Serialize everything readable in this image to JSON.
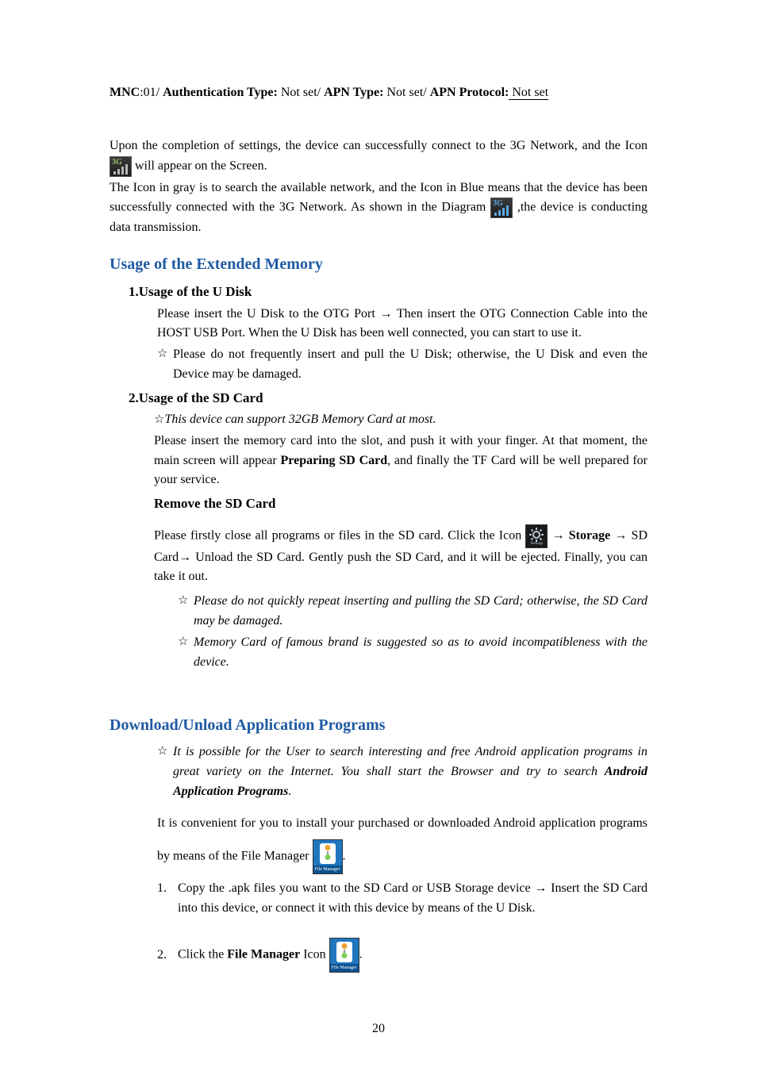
{
  "header": {
    "mnc_label": "MNC",
    "mnc_value": ":01/ ",
    "auth_label": "Authentication Type:",
    "auth_value": " Not set/   ",
    "apn_type_label": "APN Type:",
    "apn_type_value": " Not set/   ",
    "apn_proto_label": "APN Protocol:",
    "apn_proto_value": " Not set"
  },
  "para1a": "Upon the completion of settings, the device can successfully connect to the 3G Network, and the Icon",
  "para1b": "will appear on the Screen.",
  "para2a": "The Icon in gray is to search the available network, and the Icon in Blue means that the device has been successfully connected with the 3G Network. As shown in the Diagram ",
  "para2b": " ,the device is conducting data transmission.",
  "h2_a": "Usage of the Extended Memory",
  "h3_a": "1.Usage of the U Disk",
  "u_disk_p1": "Please insert the U Disk to the OTG Port → Then insert the OTG Connection Cable into the HOST USB Port. When the U Disk has been well connected, you can start to use it.",
  "u_disk_star": "Please do not frequently insert and pull the U Disk; otherwise, the U Disk and even the Device may be damaged.",
  "h3_b": "2.Usage of the SD Card",
  "sd_star1": "This device can support 32GB Memory Card at most.",
  "sd_p1a": "Please insert the memory card into the slot, and push it with your finger. At that moment, the main screen will appear ",
  "sd_p1b": "Preparing SD Card",
  "sd_p1c": ", and finally the TF Card will be well prepared for your service.",
  "h3_c": "Remove the SD Card",
  "rm_p1a": "Please firstly close all programs or files in the SD card. Click the Icon ",
  "rm_p1b": "→ ",
  "rm_p1c": "Storage",
  "rm_p1d": " → SD Card→ Unload the SD Card. Gently push the SD Card, and it will be ejected. Finally, you can take it out.",
  "rm_star1": "Please do not quickly repeat inserting and pulling the SD Card; otherwise, the SD Card may be damaged.",
  "rm_star2": "Memory Card of famous brand is suggested so as to avoid incompatibleness with the device.",
  "h2_b": "Download/Unload Application Programs",
  "dl_star_a": "It is possible for the User to search interesting and free Android application programs in great variety on the Internet. You shall start the Browser and try to search ",
  "dl_star_b": "Android Application Programs",
  "dl_star_c": ".",
  "dl_p1a": "It is convenient for you to install your purchased or downloaded Android application programs by means of the File Manager ",
  "dl_p1b": ".",
  "li1": "Copy the .apk files you want to the SD Card or USB Storage device → Insert the SD Card into this device, or connect it with this device by means of the U Disk.",
  "li2a": "Click the ",
  "li2b": "File Manager",
  "li2c": " Icon ",
  "li2d": ".",
  "num1": "1.",
  "num2": "2.",
  "star": "☆",
  "page": "20",
  "icons": {
    "settings_caption": "Settings",
    "fm_caption": "File Manager"
  }
}
